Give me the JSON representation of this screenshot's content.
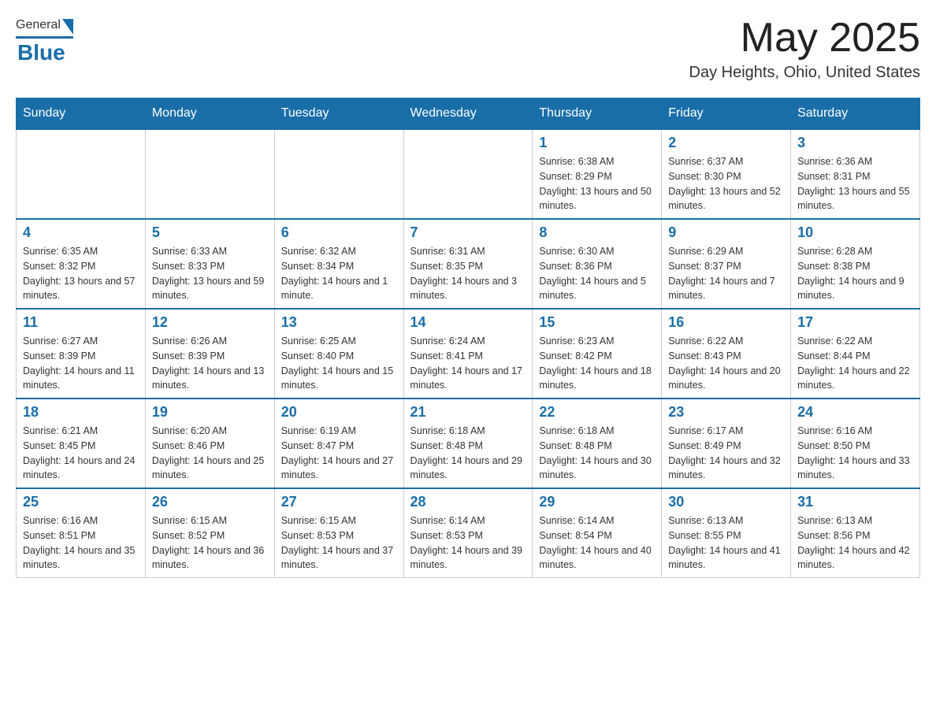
{
  "header": {
    "logo_general": "General",
    "logo_blue": "Blue",
    "month_year": "May 2025",
    "location": "Day Heights, Ohio, United States"
  },
  "days_of_week": [
    "Sunday",
    "Monday",
    "Tuesday",
    "Wednesday",
    "Thursday",
    "Friday",
    "Saturday"
  ],
  "weeks": [
    [
      {
        "day": "",
        "info": ""
      },
      {
        "day": "",
        "info": ""
      },
      {
        "day": "",
        "info": ""
      },
      {
        "day": "",
        "info": ""
      },
      {
        "day": "1",
        "info": "Sunrise: 6:38 AM\nSunset: 8:29 PM\nDaylight: 13 hours and 50 minutes."
      },
      {
        "day": "2",
        "info": "Sunrise: 6:37 AM\nSunset: 8:30 PM\nDaylight: 13 hours and 52 minutes."
      },
      {
        "day": "3",
        "info": "Sunrise: 6:36 AM\nSunset: 8:31 PM\nDaylight: 13 hours and 55 minutes."
      }
    ],
    [
      {
        "day": "4",
        "info": "Sunrise: 6:35 AM\nSunset: 8:32 PM\nDaylight: 13 hours and 57 minutes."
      },
      {
        "day": "5",
        "info": "Sunrise: 6:33 AM\nSunset: 8:33 PM\nDaylight: 13 hours and 59 minutes."
      },
      {
        "day": "6",
        "info": "Sunrise: 6:32 AM\nSunset: 8:34 PM\nDaylight: 14 hours and 1 minute."
      },
      {
        "day": "7",
        "info": "Sunrise: 6:31 AM\nSunset: 8:35 PM\nDaylight: 14 hours and 3 minutes."
      },
      {
        "day": "8",
        "info": "Sunrise: 6:30 AM\nSunset: 8:36 PM\nDaylight: 14 hours and 5 minutes."
      },
      {
        "day": "9",
        "info": "Sunrise: 6:29 AM\nSunset: 8:37 PM\nDaylight: 14 hours and 7 minutes."
      },
      {
        "day": "10",
        "info": "Sunrise: 6:28 AM\nSunset: 8:38 PM\nDaylight: 14 hours and 9 minutes."
      }
    ],
    [
      {
        "day": "11",
        "info": "Sunrise: 6:27 AM\nSunset: 8:39 PM\nDaylight: 14 hours and 11 minutes."
      },
      {
        "day": "12",
        "info": "Sunrise: 6:26 AM\nSunset: 8:39 PM\nDaylight: 14 hours and 13 minutes."
      },
      {
        "day": "13",
        "info": "Sunrise: 6:25 AM\nSunset: 8:40 PM\nDaylight: 14 hours and 15 minutes."
      },
      {
        "day": "14",
        "info": "Sunrise: 6:24 AM\nSunset: 8:41 PM\nDaylight: 14 hours and 17 minutes."
      },
      {
        "day": "15",
        "info": "Sunrise: 6:23 AM\nSunset: 8:42 PM\nDaylight: 14 hours and 18 minutes."
      },
      {
        "day": "16",
        "info": "Sunrise: 6:22 AM\nSunset: 8:43 PM\nDaylight: 14 hours and 20 minutes."
      },
      {
        "day": "17",
        "info": "Sunrise: 6:22 AM\nSunset: 8:44 PM\nDaylight: 14 hours and 22 minutes."
      }
    ],
    [
      {
        "day": "18",
        "info": "Sunrise: 6:21 AM\nSunset: 8:45 PM\nDaylight: 14 hours and 24 minutes."
      },
      {
        "day": "19",
        "info": "Sunrise: 6:20 AM\nSunset: 8:46 PM\nDaylight: 14 hours and 25 minutes."
      },
      {
        "day": "20",
        "info": "Sunrise: 6:19 AM\nSunset: 8:47 PM\nDaylight: 14 hours and 27 minutes."
      },
      {
        "day": "21",
        "info": "Sunrise: 6:18 AM\nSunset: 8:48 PM\nDaylight: 14 hours and 29 minutes."
      },
      {
        "day": "22",
        "info": "Sunrise: 6:18 AM\nSunset: 8:48 PM\nDaylight: 14 hours and 30 minutes."
      },
      {
        "day": "23",
        "info": "Sunrise: 6:17 AM\nSunset: 8:49 PM\nDaylight: 14 hours and 32 minutes."
      },
      {
        "day": "24",
        "info": "Sunrise: 6:16 AM\nSunset: 8:50 PM\nDaylight: 14 hours and 33 minutes."
      }
    ],
    [
      {
        "day": "25",
        "info": "Sunrise: 6:16 AM\nSunset: 8:51 PM\nDaylight: 14 hours and 35 minutes."
      },
      {
        "day": "26",
        "info": "Sunrise: 6:15 AM\nSunset: 8:52 PM\nDaylight: 14 hours and 36 minutes."
      },
      {
        "day": "27",
        "info": "Sunrise: 6:15 AM\nSunset: 8:53 PM\nDaylight: 14 hours and 37 minutes."
      },
      {
        "day": "28",
        "info": "Sunrise: 6:14 AM\nSunset: 8:53 PM\nDaylight: 14 hours and 39 minutes."
      },
      {
        "day": "29",
        "info": "Sunrise: 6:14 AM\nSunset: 8:54 PM\nDaylight: 14 hours and 40 minutes."
      },
      {
        "day": "30",
        "info": "Sunrise: 6:13 AM\nSunset: 8:55 PM\nDaylight: 14 hours and 41 minutes."
      },
      {
        "day": "31",
        "info": "Sunrise: 6:13 AM\nSunset: 8:56 PM\nDaylight: 14 hours and 42 minutes."
      }
    ]
  ]
}
